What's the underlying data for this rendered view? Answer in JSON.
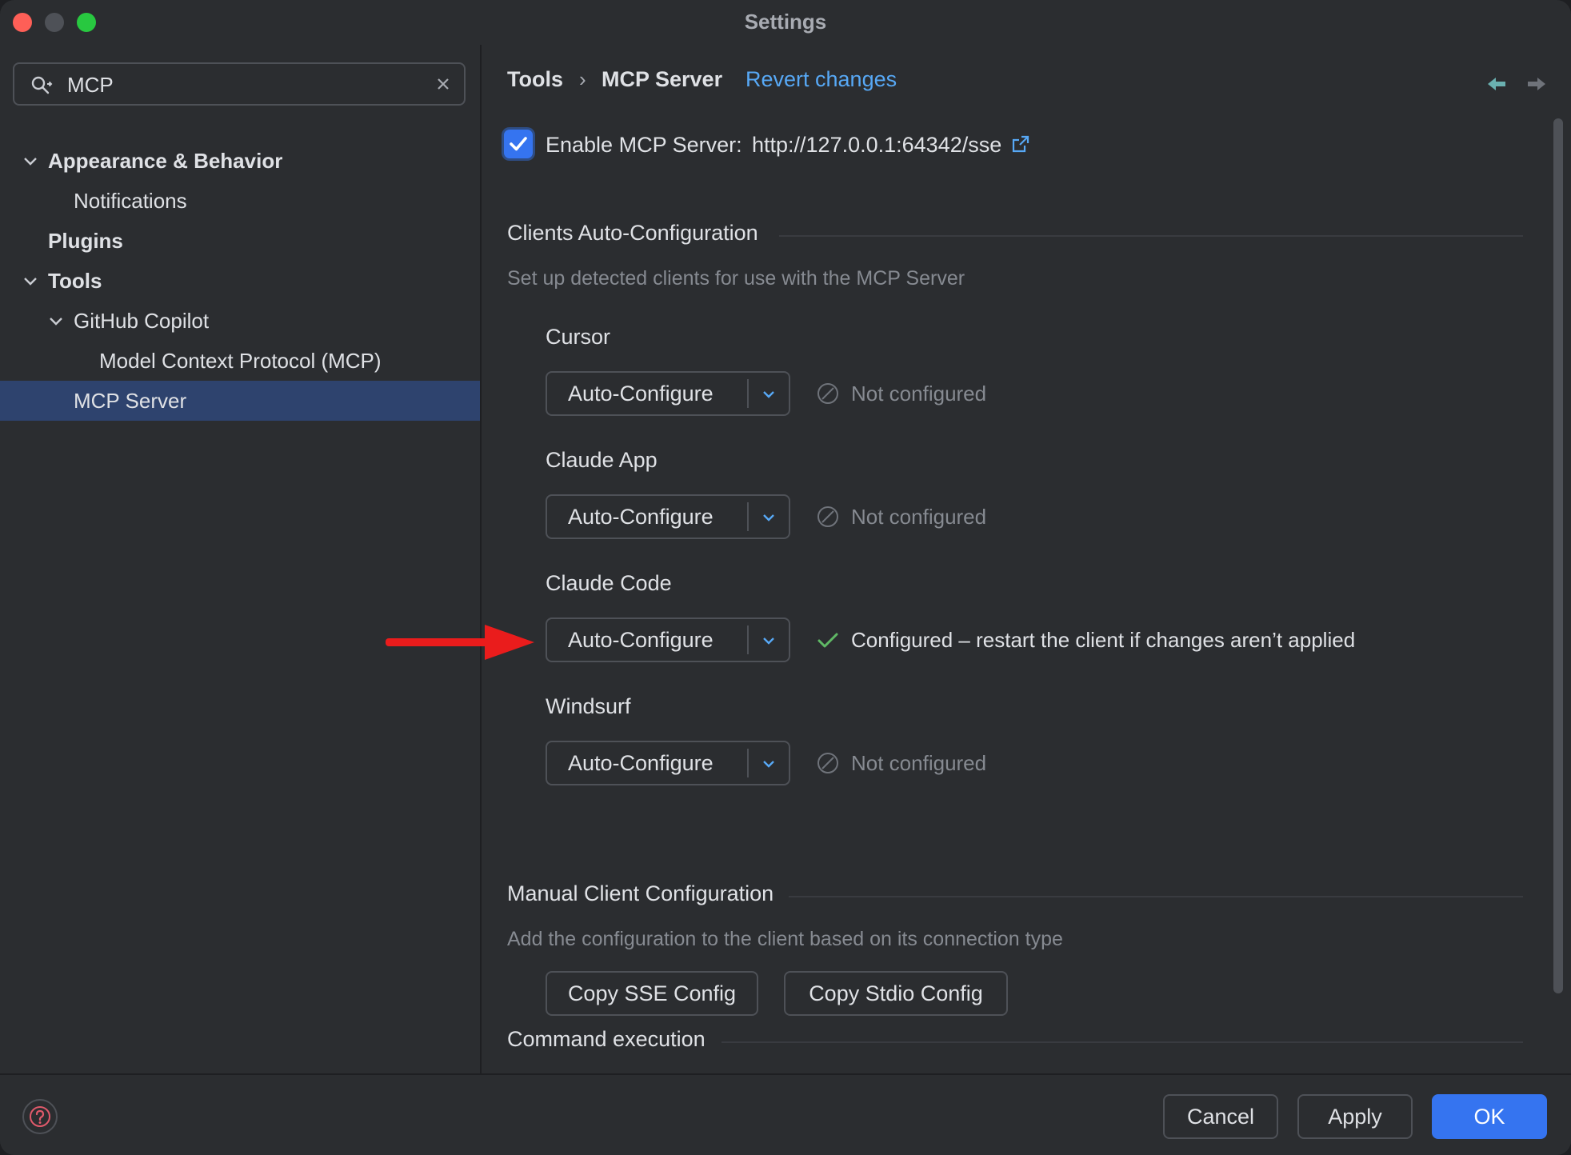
{
  "window": {
    "title": "Settings"
  },
  "sidebar": {
    "search": {
      "value": "MCP"
    },
    "items": [
      {
        "label": "Appearance & Behavior"
      },
      {
        "label": "Notifications"
      },
      {
        "label": "Plugins"
      },
      {
        "label": "Tools"
      },
      {
        "label": "GitHub Copilot"
      },
      {
        "label": "Model Context Protocol (MCP)"
      },
      {
        "label": "MCP Server",
        "selected": true
      }
    ]
  },
  "main": {
    "breadcrumb": {
      "parent": "Tools",
      "separator": "›",
      "current": "MCP Server"
    },
    "revert_label": "Revert changes",
    "enable": {
      "label": "Enable MCP Server:",
      "url": "http://127.0.0.1:64342/sse",
      "checked": true
    },
    "auto_config": {
      "title": "Clients Auto-Configuration",
      "description": "Set up detected clients for use with the MCP Server",
      "clients": [
        {
          "name": "Cursor",
          "action": "Auto-Configure",
          "status": "Not configured",
          "configured": false
        },
        {
          "name": "Claude App",
          "action": "Auto-Configure",
          "status": "Not configured",
          "configured": false
        },
        {
          "name": "Claude Code",
          "action": "Auto-Configure",
          "status": "Configured – restart the client if changes aren’t applied",
          "configured": true
        },
        {
          "name": "Windsurf",
          "action": "Auto-Configure",
          "status": "Not configured",
          "configured": false
        }
      ]
    },
    "manual_config": {
      "title": "Manual Client Configuration",
      "description": "Add the configuration to the client based on its connection type",
      "copy_sse_label": "Copy SSE Config",
      "copy_stdio_label": "Copy Stdio Config"
    },
    "command_execution": {
      "title": "Command execution"
    }
  },
  "footer": {
    "cancel_label": "Cancel",
    "apply_label": "Apply",
    "ok_label": "OK"
  },
  "colors": {
    "accent": "#3574f0",
    "link": "#57a8f5",
    "selection": "#2e436e",
    "success": "#5fb865",
    "annotation_arrow": "#ea1c1c"
  }
}
